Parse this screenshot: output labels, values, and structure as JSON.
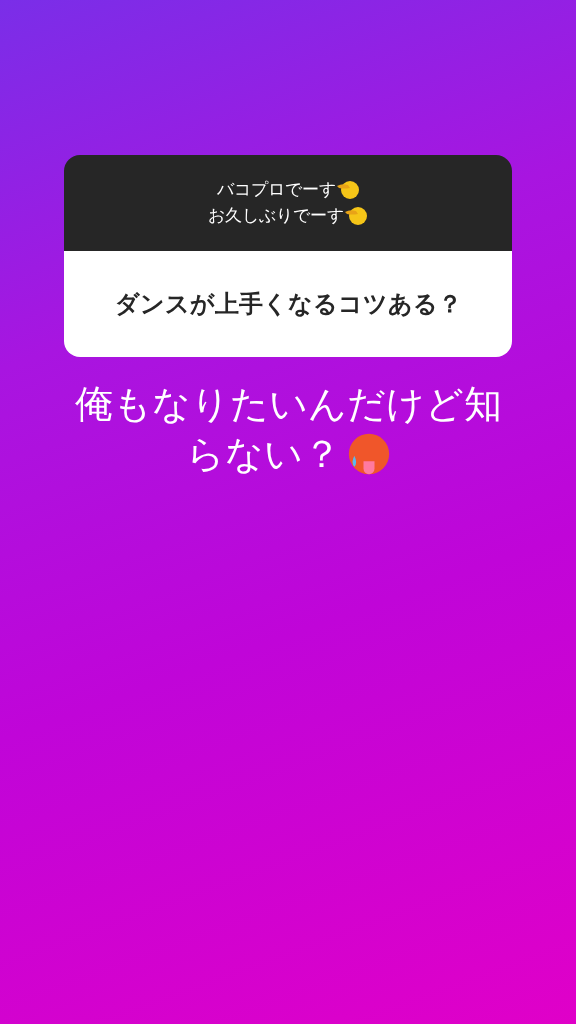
{
  "question_card": {
    "header_lines": [
      "バコプロでーす",
      "お久しぶりでーす"
    ],
    "question": "ダンスが上手くなるコツある？"
  },
  "caption_lines": [
    "俺もなりたいんだけど知",
    "らない？"
  ]
}
